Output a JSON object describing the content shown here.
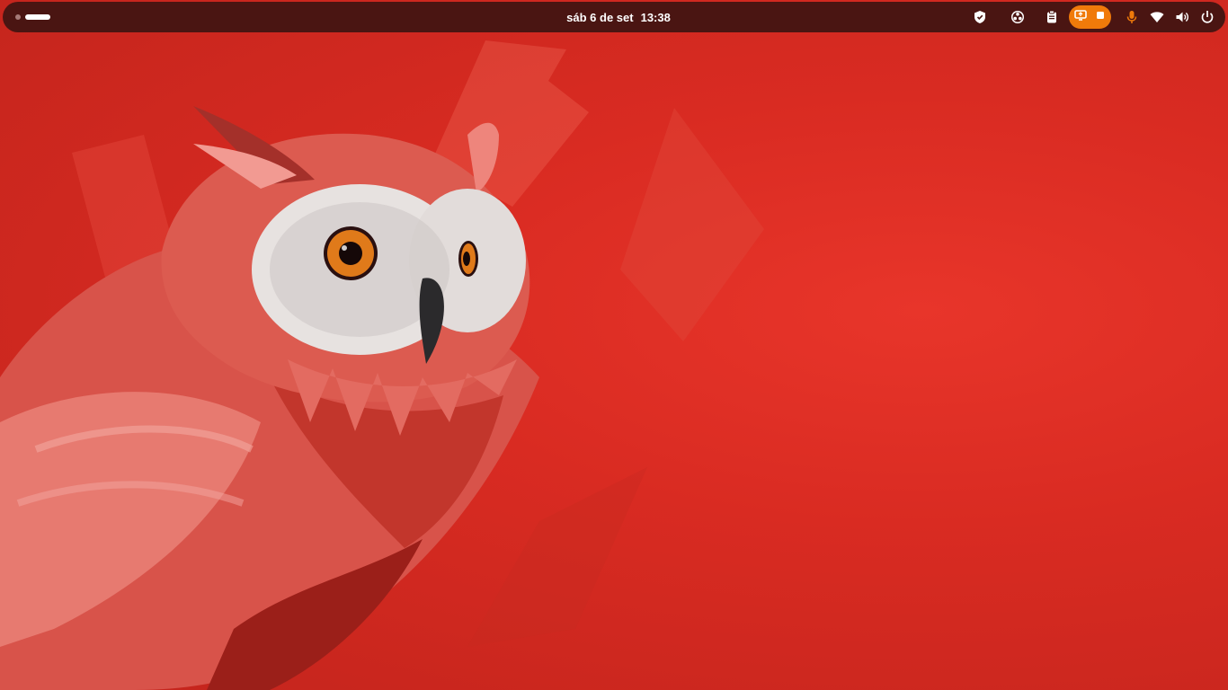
{
  "topbar": {
    "date": "sáb 6 de set",
    "time": "13:38"
  },
  "workspaces": {
    "count": 2,
    "active": 2
  },
  "tray_icons": [
    "shield-icon",
    "obs-icon",
    "clipboard-icon",
    "screen-share-icon",
    "stop-recording-icon",
    "microphone-icon",
    "wifi-icon",
    "volume-icon",
    "power-icon"
  ],
  "colors": {
    "panel": "#4a1512",
    "accent": "#f07a0a",
    "wallpaper": "#d92b22"
  }
}
